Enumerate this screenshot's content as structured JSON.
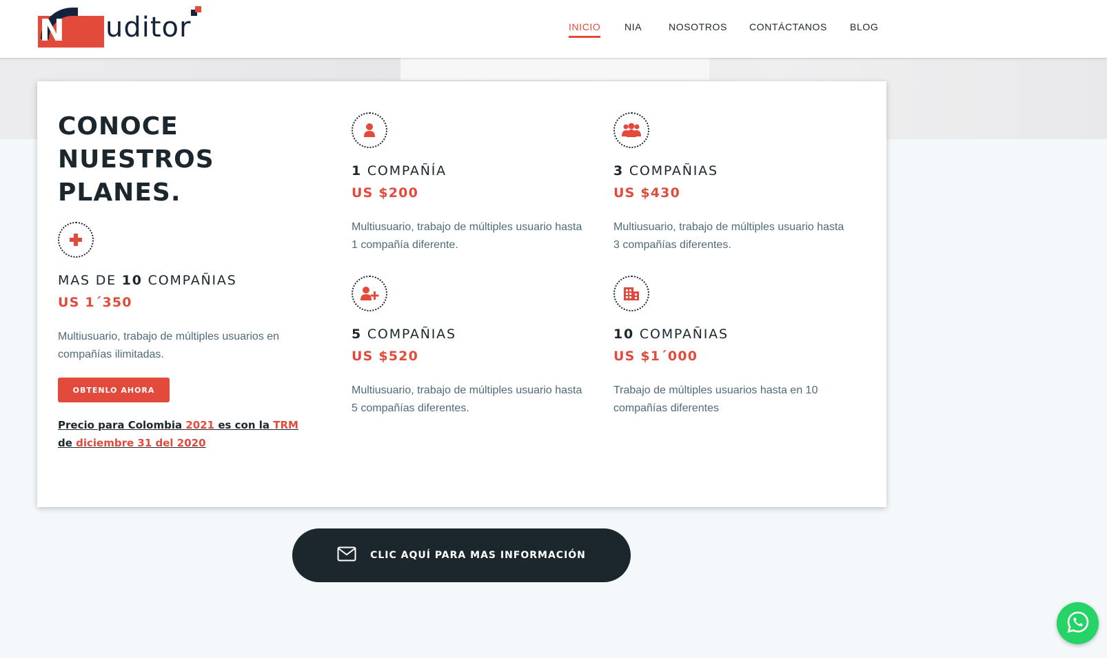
{
  "brand": {
    "logo_letter": "N",
    "logo_rest": "uditor",
    "logo_text": "Niauditor",
    "colors": {
      "accent": "#e24a3b",
      "dark": "#1c272d",
      "navy": "#14233c",
      "muted": "#4f6b7a",
      "whatsapp": "#25d366"
    }
  },
  "nav": {
    "items": [
      {
        "label": "INICIO",
        "active": true
      },
      {
        "label": "NIA",
        "active": false
      },
      {
        "label": "NOSOTROS",
        "active": false
      },
      {
        "label": "CONTÁCTANOS",
        "active": false
      },
      {
        "label": "BLOG",
        "active": false
      }
    ]
  },
  "plans_section": {
    "title_line1": "CONOCE",
    "title_line2": "NUESTROS",
    "title_line3": "PLANES.",
    "plans": [
      {
        "icon": "plus-icon",
        "name_prefix": "MAS DE ",
        "name_bold": "10",
        "name_suffix": " COMPAÑIAS",
        "price": "US 1´350",
        "desc": "Multiusuario, trabajo de múltiples usuarios en compañías ilimitadas."
      },
      {
        "icon": "user-icon",
        "name_prefix": "",
        "name_bold": "1",
        "name_suffix": " COMPAÑÍA",
        "price": "US $200",
        "desc": "Multiusuario, trabajo de múltiples usuario hasta 1 compañía diferente."
      },
      {
        "icon": "users-group-icon",
        "name_prefix": "",
        "name_bold": "3",
        "name_suffix": " COMPAÑIAS",
        "price": "US $430",
        "desc": "Multiusuario, trabajo de múltiples usuario hasta 3 compañías diferentes."
      },
      {
        "icon": "user-plus-icon",
        "name_prefix": "",
        "name_bold": "5",
        "name_suffix": " COMPAÑIAS",
        "price": "US $520",
        "desc": "Multiusuario, trabajo de múltiples usuario hasta 5 compañías diferentes."
      },
      {
        "icon": "building-icon",
        "name_prefix": "",
        "name_bold": "10",
        "name_suffix": " COMPAÑIAS",
        "price": "US $1´000",
        "desc": "Trabajo de múltiples usuarios hasta en 10 compañías diferentes"
      }
    ],
    "cta_button": "OBTENLO AHORA",
    "trm": {
      "part1": "Precio para Colombia ",
      "year": "2021",
      "part2": " es con la ",
      "trm": "TRM",
      "part3": " de ",
      "date": "diciembre 31 del 2020 "
    }
  },
  "info_cta": {
    "icon": "envelope-icon",
    "label": "CLIC AQUÍ PARA MAS INFORMACIÓN"
  },
  "whatsapp": {
    "icon": "whatsapp-icon"
  }
}
